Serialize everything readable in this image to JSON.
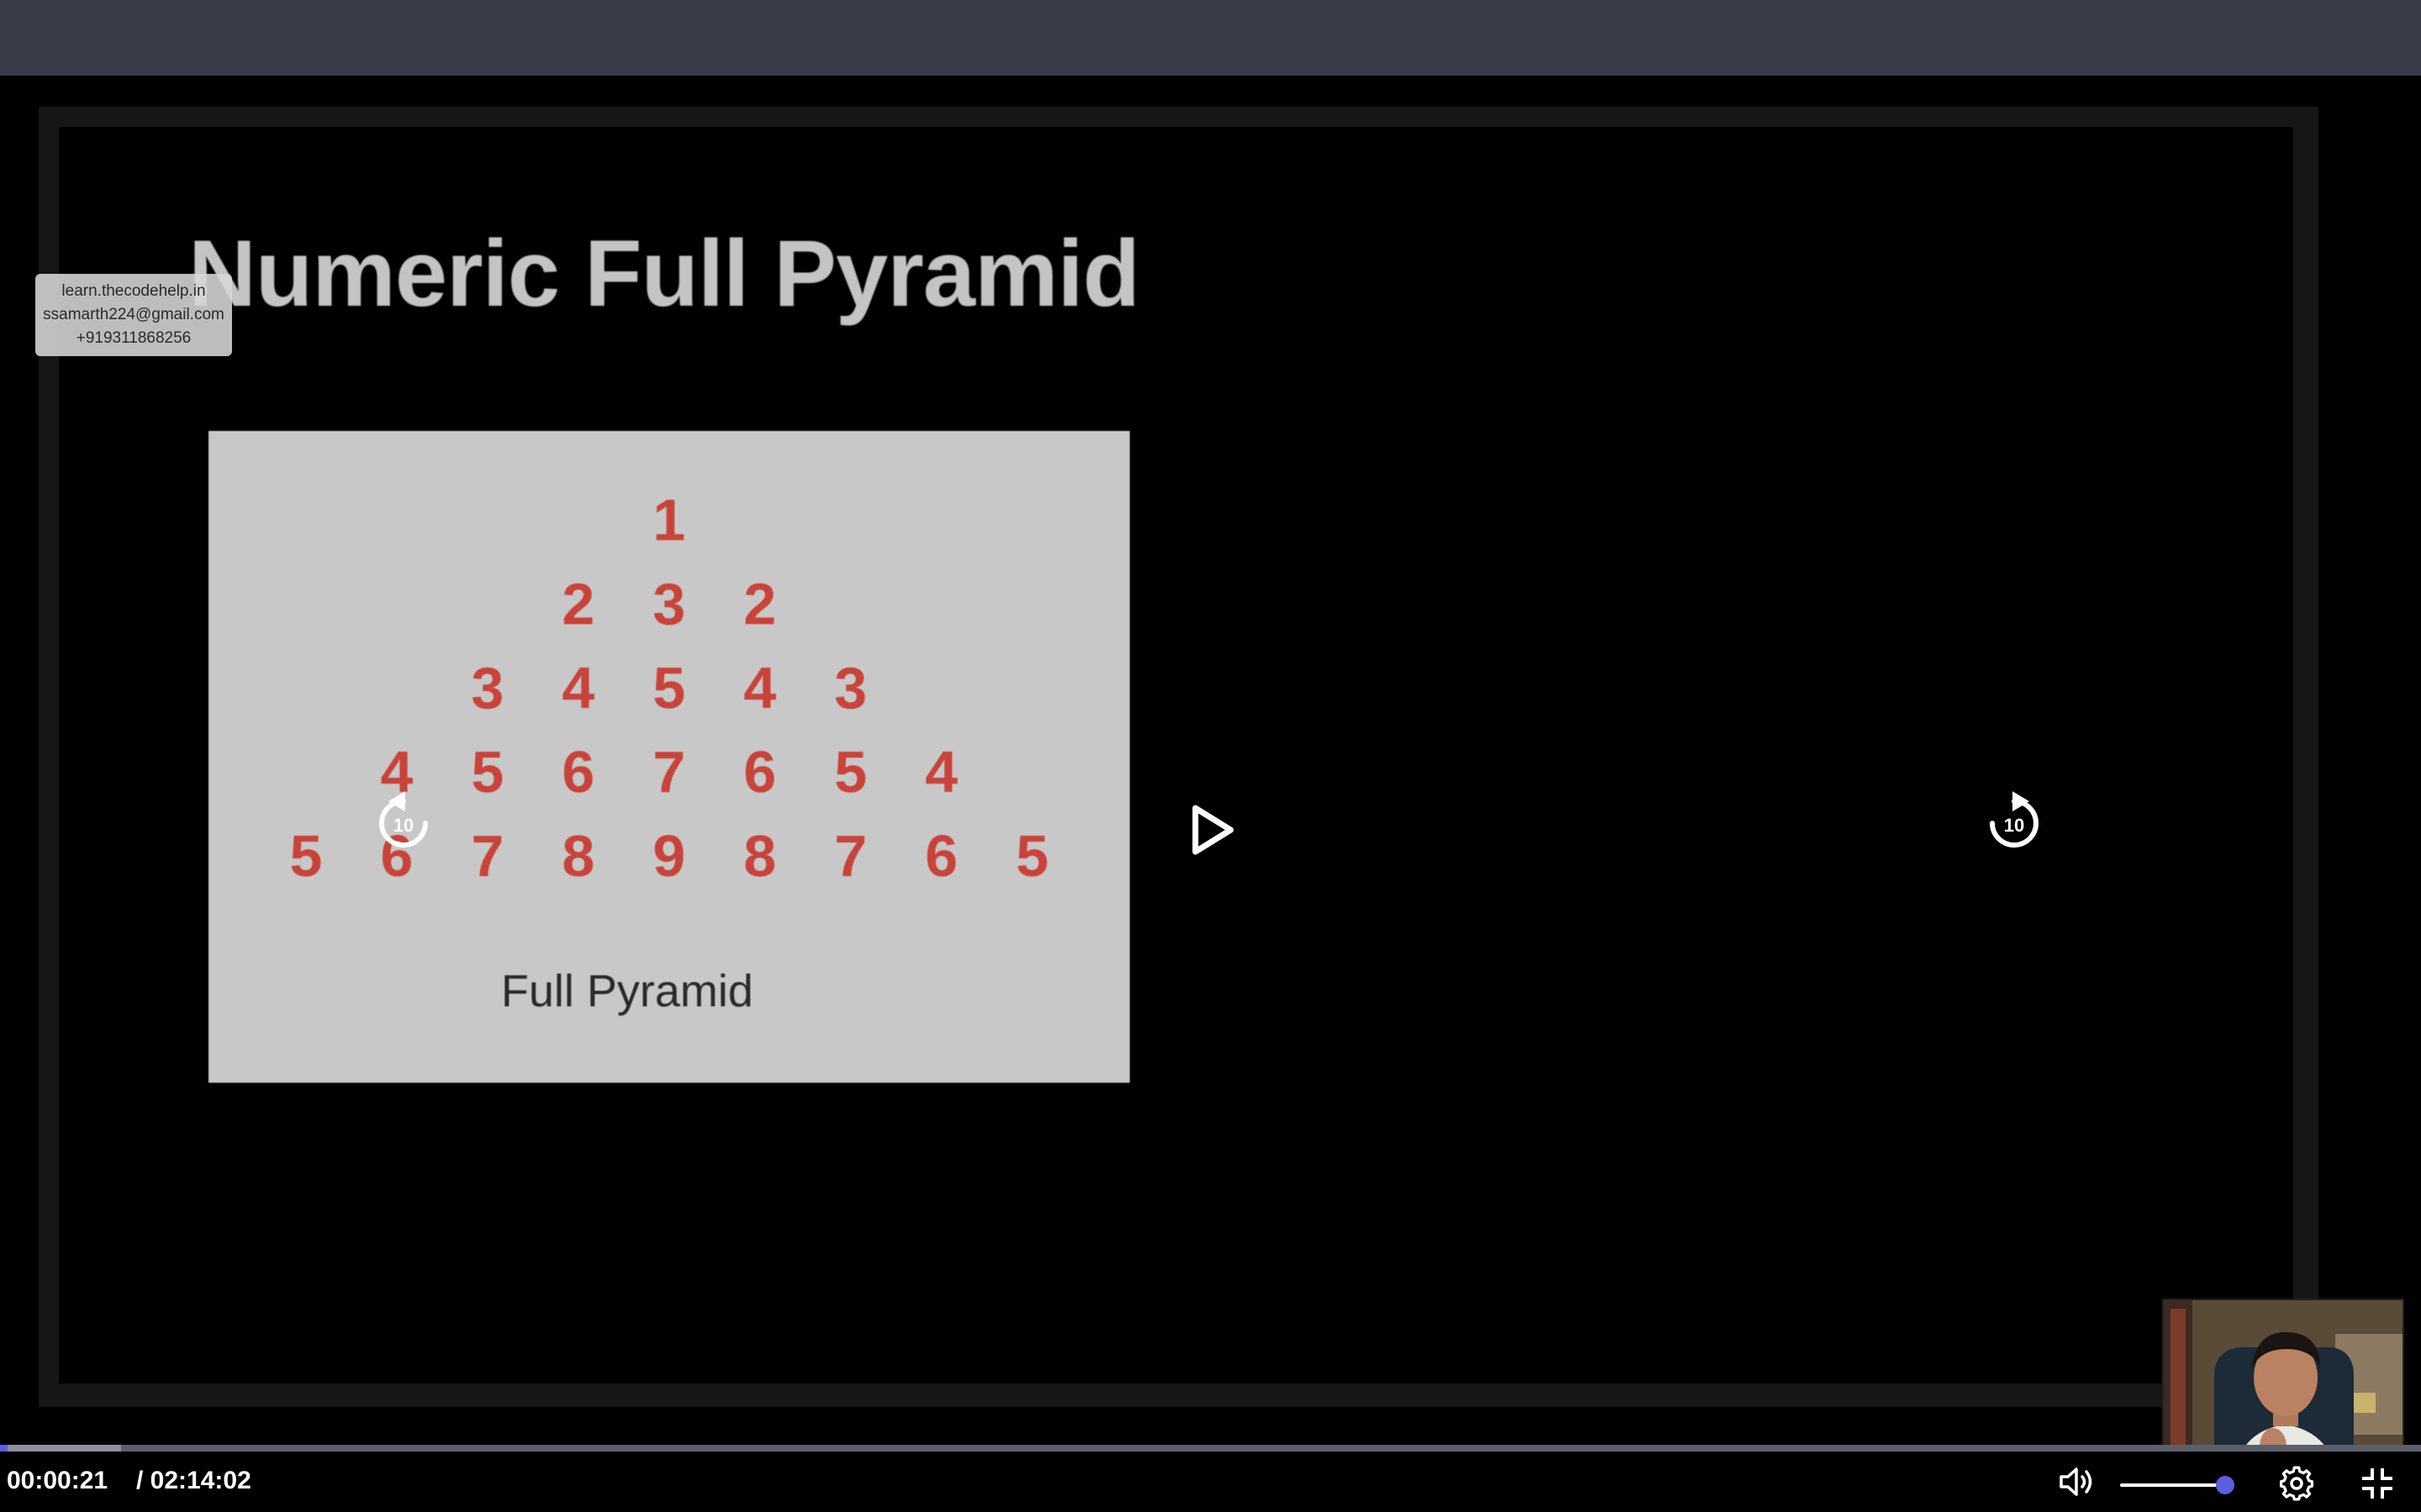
{
  "slide": {
    "title": "Numeric Full Pyramid",
    "pyramid_rows": [
      [
        "1"
      ],
      [
        "2",
        "3",
        "2"
      ],
      [
        "3",
        "4",
        "5",
        "4",
        "3"
      ],
      [
        "4",
        "5",
        "6",
        "7",
        "6",
        "5",
        "4"
      ],
      [
        "5",
        "6",
        "7",
        "8",
        "9",
        "8",
        "7",
        "6",
        "5"
      ]
    ],
    "caption": "Full Pyramid"
  },
  "watermark": {
    "site": "learn.thecodehelp.in",
    "email": "ssamarth224@gmail.com",
    "phone": "+919311868256"
  },
  "overlay_controls": {
    "rewind_seconds": "10",
    "forward_seconds": "10",
    "rewind_icon": "rewind-10-icon",
    "play_icon": "play-icon",
    "forward_icon": "forward-10-icon"
  },
  "player": {
    "current_time": "00:00:21",
    "total_time": "/ 02:14:02",
    "played_fraction": 0.003,
    "buffered_fraction": 0.05,
    "volume_fraction": 0.93,
    "icons": [
      "volume-icon",
      "settings-icon",
      "exit-fullscreen-icon"
    ]
  },
  "colors": {
    "top_bar": "#373c48",
    "accent": "#5b5ee0",
    "pyramid_digits": "#c8433a",
    "pyramid_card": "#c8c8c8",
    "slide_title": "#c4c4c4"
  }
}
